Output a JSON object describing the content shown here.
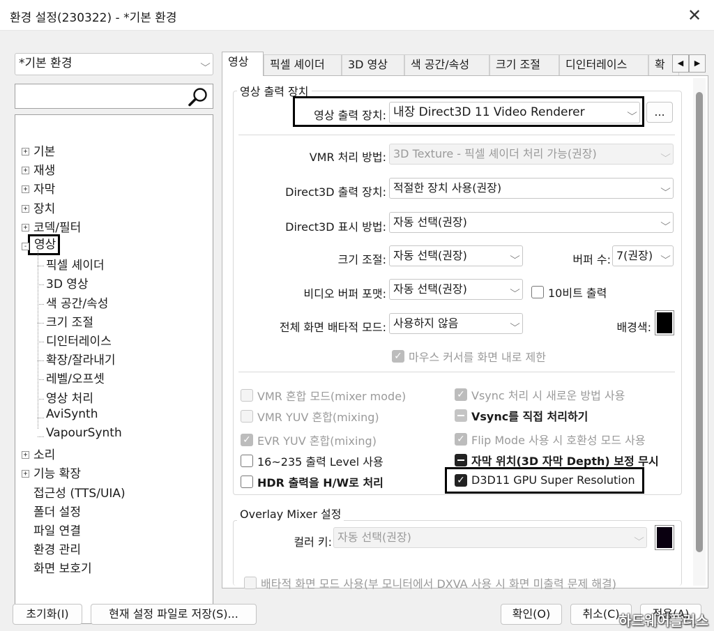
{
  "window": {
    "title": "환경 설정(230322) - *기본 환경",
    "close_glyph": "✕"
  },
  "preset": {
    "value": "*기본 환경"
  },
  "search": {
    "value": ""
  },
  "tree": {
    "items": [
      {
        "label": "기본",
        "level": 0,
        "expander": "+"
      },
      {
        "label": "재생",
        "level": 0,
        "expander": "+"
      },
      {
        "label": "자막",
        "level": 0,
        "expander": "+"
      },
      {
        "label": "장치",
        "level": 0,
        "expander": "+"
      },
      {
        "label": "코덱/필터",
        "level": 0,
        "expander": "+"
      },
      {
        "label": "영상",
        "level": 0,
        "expander": "-",
        "selected": true
      },
      {
        "label": "픽셀 셰이더",
        "level": 1
      },
      {
        "label": "3D 영상",
        "level": 1
      },
      {
        "label": "색 공간/속성",
        "level": 1
      },
      {
        "label": "크기 조절",
        "level": 1
      },
      {
        "label": "디인터레이스",
        "level": 1
      },
      {
        "label": "확장/잘라내기",
        "level": 1
      },
      {
        "label": "레벨/오프셋",
        "level": 1
      },
      {
        "label": "영상 처리",
        "level": 1
      },
      {
        "label": "AviSynth",
        "level": 1
      },
      {
        "label": "VapourSynth",
        "level": 1
      },
      {
        "label": "소리",
        "level": 0,
        "expander": "+"
      },
      {
        "label": "기능 확장",
        "level": 0,
        "expander": "+"
      },
      {
        "label": "접근성 (TTS/UIA)",
        "level": 0
      },
      {
        "label": "폴더 설정",
        "level": 0
      },
      {
        "label": "파일 연결",
        "level": 0
      },
      {
        "label": "환경 관리",
        "level": 0
      },
      {
        "label": "화면 보호기",
        "level": 0
      }
    ]
  },
  "tabs": {
    "items": [
      "영상",
      "픽셀 셰이더",
      "3D 영상",
      "색 공간/속성",
      "크기 조절",
      "디인터레이스",
      "확"
    ],
    "nav_left": "◀",
    "nav_right": "▶"
  },
  "output": {
    "group_title": "영상 출력 장치",
    "device_label": "영상 출력 장치:",
    "device_value": "내장 Direct3D 11 Video Renderer",
    "more_button": "...",
    "vmr_label": "VMR 처리 방법:",
    "vmr_value": "3D Texture - 픽셀 셰이더 처리 가능(권장)",
    "d3d_device_label": "Direct3D 출력 장치:",
    "d3d_device_value": "적절한 장치 사용(권장)",
    "d3d_display_label": "Direct3D 표시 방법:",
    "d3d_display_value": "자동 선택(권장)",
    "resize_label": "크기 조절:",
    "resize_value": "자동 선택(권장)",
    "buffer_label": "버퍼 수:",
    "buffer_value": "7(권장)",
    "format_label": "비디오 버퍼 포맷:",
    "format_value": "자동 선택(권장)",
    "tenbit": "10비트 출력",
    "fullscreen_label": "전체 화면 배타적 모드:",
    "fullscreen_value": "사용하지 않음",
    "bgcolor_label": "배경색:",
    "bgcolor": "#000000",
    "mouse_limit": "마우스 커서를 화면 내로 제한"
  },
  "options": {
    "vmr_mixer": "VMR 혼합 모드(mixer mode)",
    "vmr_yuv": "VMR YUV 혼합(mixing)",
    "evr_yuv": "EVR YUV 혼합(mixing)",
    "level_16_235": "16~235 출력 Level 사용",
    "hdr_hw": "HDR 출력을 H/W로 처리",
    "vsync_new": "Vsync 처리 시 새로운 방법 사용",
    "vsync_direct": "Vsync를 직접 처리하기",
    "flip_mode": "Flip Mode 사용 시 호환성 모드 사용",
    "subtitle_pos": "자막 위치(3D 자막 Depth) 보정 무시",
    "super_res": "D3D11 GPU Super Resolution"
  },
  "overlay": {
    "group_title": "Overlay Mixer 설정",
    "colorkey_label": "컬러 키:",
    "colorkey_value": "자동 선택(권장)",
    "colorkey_color": "#0a0010",
    "exclusive": "배타적 화면 모드 사용(부 모니터에서 DXVA 사용 시 화면 미출력 문제 해결)"
  },
  "footer": {
    "reset": "초기화(I)",
    "save_file": "현재 설정 파일로 저장(S)...",
    "ok": "확인(O)",
    "cancel": "취소(C)",
    "apply": "적용(A)"
  },
  "watermark": "하드웨어플러스"
}
